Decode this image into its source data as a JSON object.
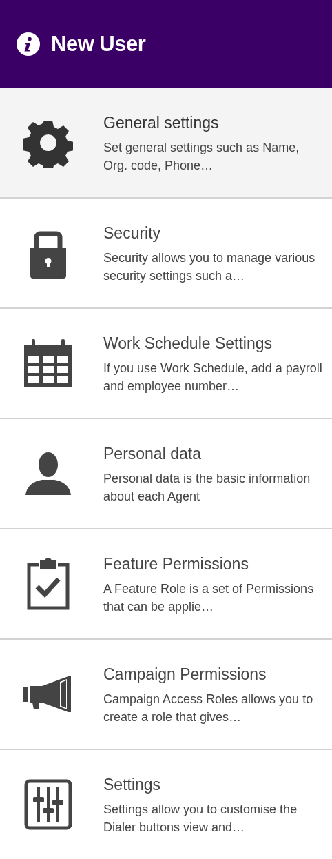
{
  "header": {
    "title": "New User"
  },
  "items": [
    {
      "title": "General settings",
      "description": "Set general settings such as Name, Org. code, Phone…",
      "selected": true
    },
    {
      "title": "Security",
      "description": "Security allows you to manage various security settings such a…",
      "selected": false
    },
    {
      "title": "Work Schedule Settings",
      "description": "If you use Work Schedule, add a payroll and employee number…",
      "selected": false
    },
    {
      "title": "Personal data",
      "description": "Personal data is the basic information about each Agent",
      "selected": false
    },
    {
      "title": "Feature Permissions",
      "description": "A Feature Role is a set of Permissions that can be applie…",
      "selected": false
    },
    {
      "title": "Campaign Permissions",
      "description": "Campaign Access Roles allows you to create a role that gives…",
      "selected": false
    },
    {
      "title": "Settings",
      "description": "Settings allow you to customise the Dialer buttons view and…",
      "selected": false
    }
  ]
}
